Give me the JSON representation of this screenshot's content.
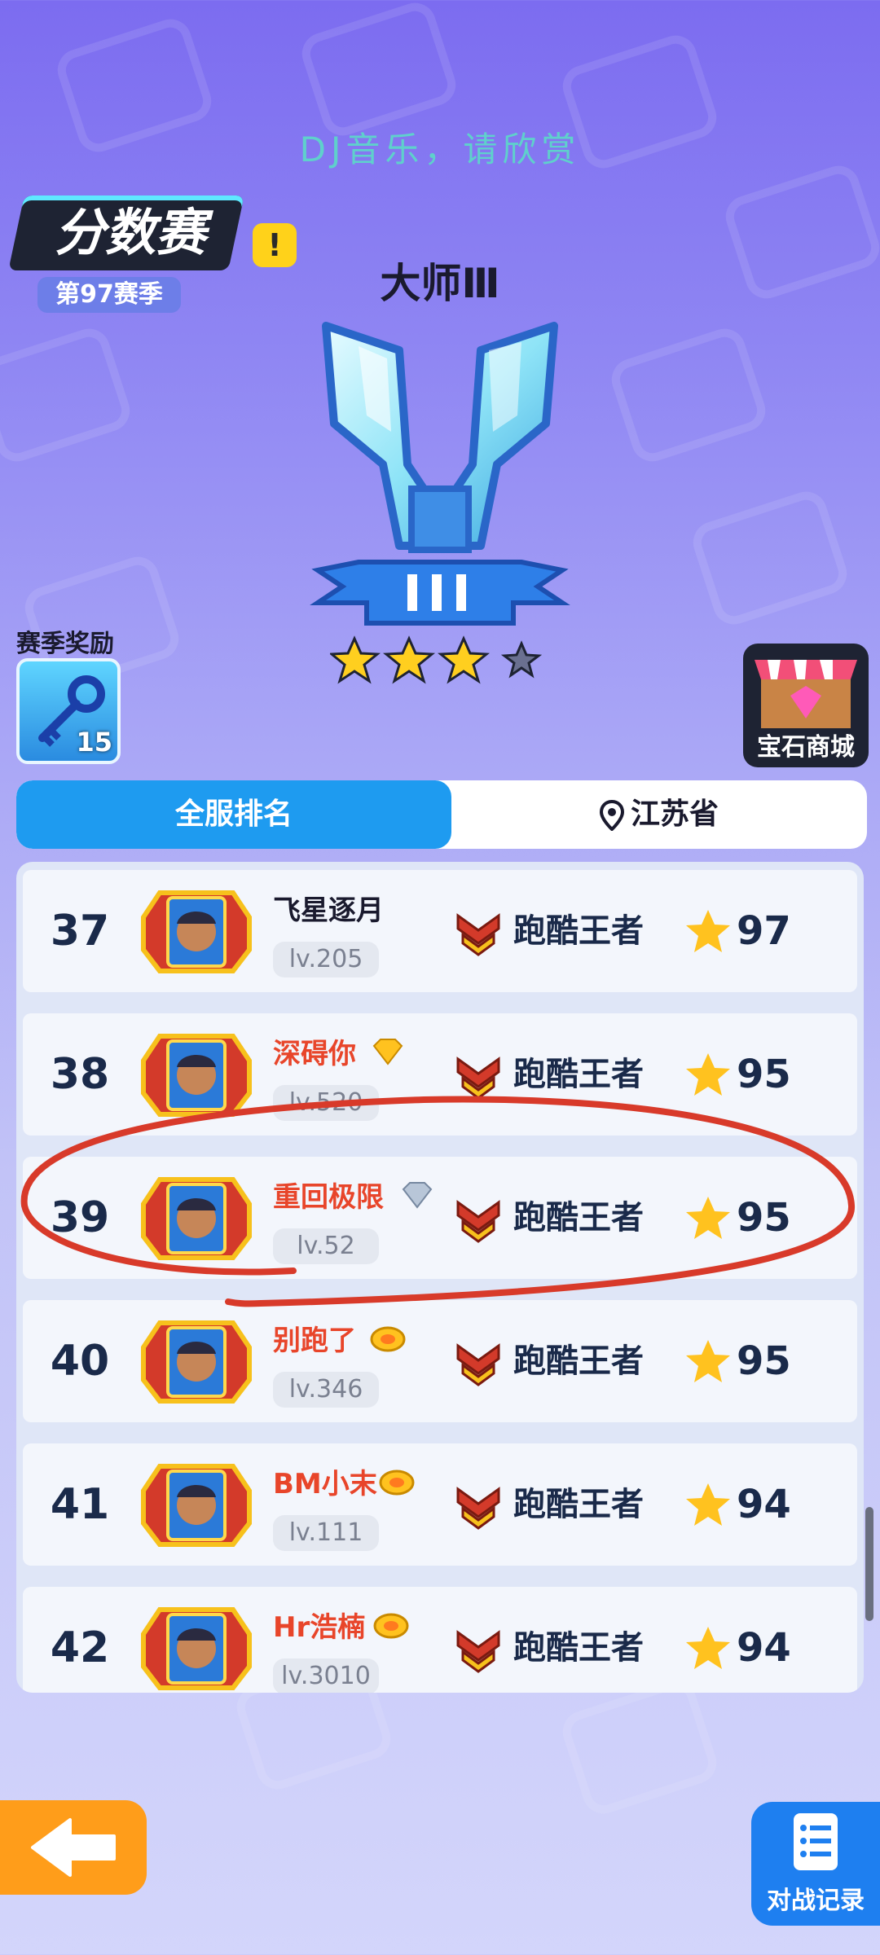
{
  "banner_text": "DJ音乐，请欣赏",
  "mode": {
    "title": "分数赛",
    "season": "第97赛季",
    "info_icon": "exclamation-icon"
  },
  "rank": {
    "name": "大师Ⅲ",
    "stars_filled": 3,
    "stars_total": 4
  },
  "season_reward": {
    "label": "赛季奖励",
    "count": "15",
    "icon": "key-icon"
  },
  "gem_shop": {
    "label": "宝石商城",
    "icon": "gem-shop-icon"
  },
  "tabs": {
    "national": "全服排名",
    "province": "江苏省"
  },
  "colors": {
    "accent_blue": "#1e9bf0",
    "name_red": "#e8452a",
    "back_orange": "#ff9d1a",
    "annotation_red": "#d83a2a"
  },
  "players": [
    {
      "rank": "37",
      "name": "飞星逐月",
      "level": "lv.205",
      "tier": "跑酷王者",
      "score": "97",
      "badge": "none",
      "name_color": "black"
    },
    {
      "rank": "38",
      "name": "深碍你",
      "level": "lv.520",
      "tier": "跑酷王者",
      "score": "95",
      "badge": "gold-diamond-icon",
      "name_color": "red"
    },
    {
      "rank": "39",
      "name": "重回极限",
      "level": "lv.52",
      "tier": "跑酷王者",
      "score": "95",
      "badge": "silver-diamond-icon",
      "name_color": "red"
    },
    {
      "rank": "40",
      "name": "别跑了",
      "level": "lv.346",
      "tier": "跑酷王者",
      "score": "95",
      "badge": "gold-wreath-icon",
      "name_color": "red"
    },
    {
      "rank": "41",
      "name": "BM小末",
      "level": "lv.111",
      "tier": "跑酷王者",
      "score": "94",
      "badge": "gold-wreath-icon",
      "name_color": "red"
    },
    {
      "rank": "42",
      "name": "Hr浩楠",
      "level": "lv.3010",
      "tier": "跑酷王者",
      "score": "94",
      "badge": "gold-wreath-icon",
      "name_color": "red"
    }
  ],
  "bottom": {
    "record_label": "对战记录",
    "back_icon": "back-arrow-icon",
    "record_icon": "record-list-icon"
  }
}
